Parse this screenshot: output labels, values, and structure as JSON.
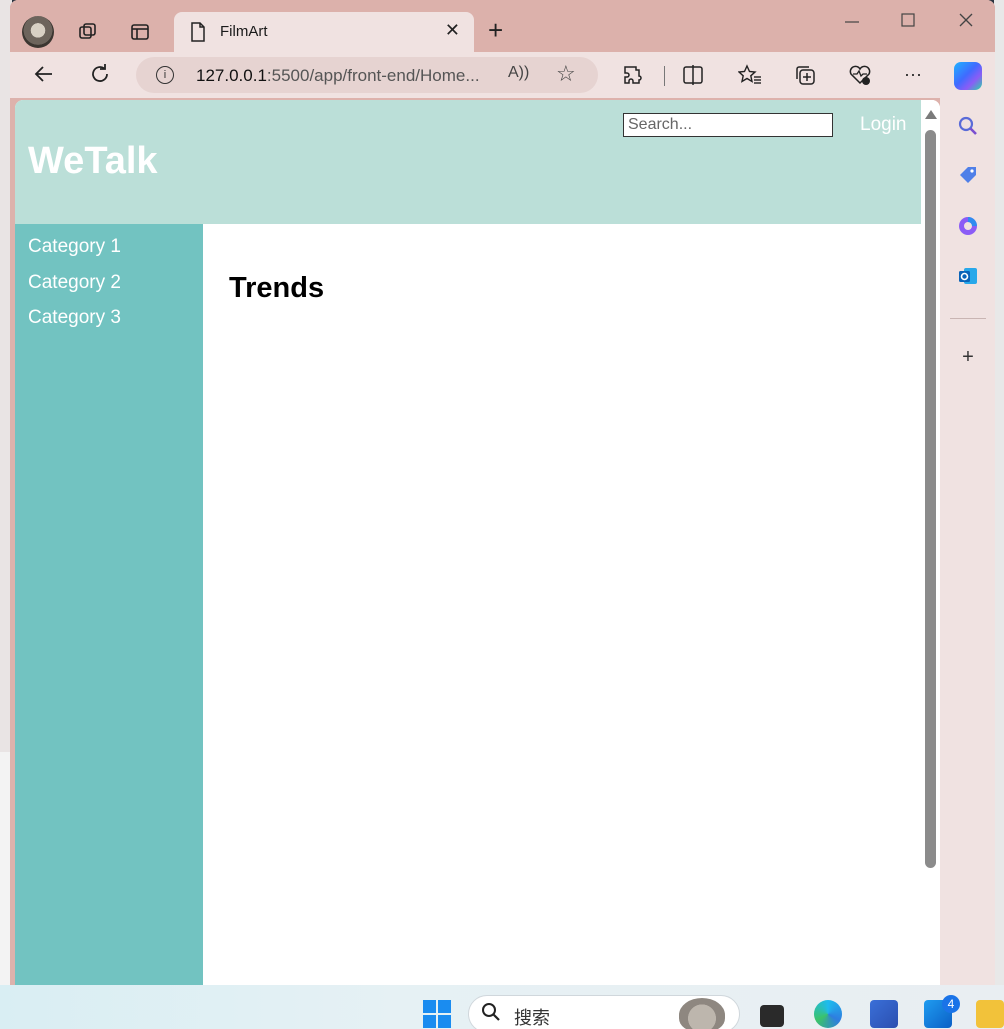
{
  "browser": {
    "tab_title": "FilmArt",
    "url_host": "127.0.0.1",
    "url_path": ":5500/app/front-end/Home...",
    "new_tab_symbol": "+",
    "tab_close_symbol": "✕"
  },
  "site": {
    "logo": "WeTalk",
    "search_placeholder": "Search...",
    "login_label": "Login",
    "categories": [
      "Category 1",
      "Category 2",
      "Category 3"
    ],
    "main_heading": "Trends"
  },
  "taskbar": {
    "search_text": "搜索",
    "mail_badge": "4"
  },
  "colors": {
    "header_bg": "#bbdfd8",
    "sidebar_bg": "#72c3c1",
    "browser_frame": "#dcb1ab"
  },
  "icons": [
    "profile-avatar",
    "workspaces-icon",
    "tab-actions-icon",
    "page-icon",
    "back-icon",
    "refresh-icon",
    "info-icon",
    "read-aloud-icon",
    "favorite-star-icon",
    "extensions-icon",
    "split-screen-icon",
    "favorites-icon",
    "collections-icon",
    "browser-essentials-icon",
    "more-icon",
    "copilot-icon",
    "search-sidebar-icon",
    "shopping-icon",
    "m365-icon",
    "outlook-icon",
    "add-sidebar-icon"
  ]
}
